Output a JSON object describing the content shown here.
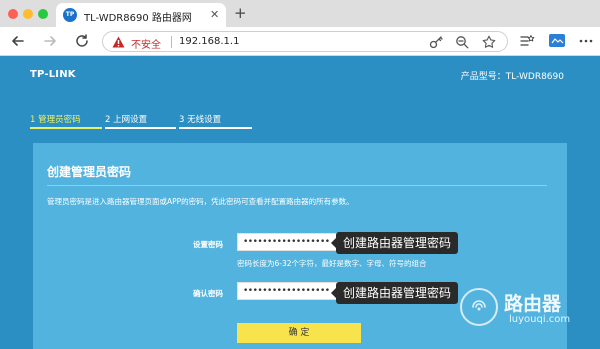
{
  "browser": {
    "tab_title": "TL-WDR8690 路由器网",
    "tab_favicon_text": "TP",
    "insecure_label": "不安全",
    "url": "192.168.1.1"
  },
  "router": {
    "logo": "TP-LINK",
    "model_label": "产品型号：TL-WDR8690",
    "steps": [
      {
        "label": "1 管理员密码",
        "active": true
      },
      {
        "label": "2 上网设置",
        "active": false
      },
      {
        "label": "3 无线设置",
        "active": false
      }
    ],
    "card": {
      "title": "创建管理员密码",
      "description": "管理员密码是进入路由器管理页面或APP的密码，凭此密码可查看并配置路由器的所有参数。",
      "password_label": "设置密码",
      "password_value": "••••••••••••••••••",
      "hint": "密码长度为6-32个字符，最好是数字、字母、符号的组合",
      "confirm_label": "确认密码",
      "confirm_value": "••••••••••••••••••",
      "button": "确 定"
    },
    "callout_1": "创建路由器管理密码",
    "callout_2": "创建路由器管理密码"
  },
  "watermark": {
    "text": "路由器",
    "sub": "luyouqi.com"
  },
  "colors": {
    "page_bg": "#2b8fc4",
    "card_bg": "#53b3df",
    "active_step": "#e8f16a",
    "button": "#f7e44d",
    "required": "#e53935"
  }
}
